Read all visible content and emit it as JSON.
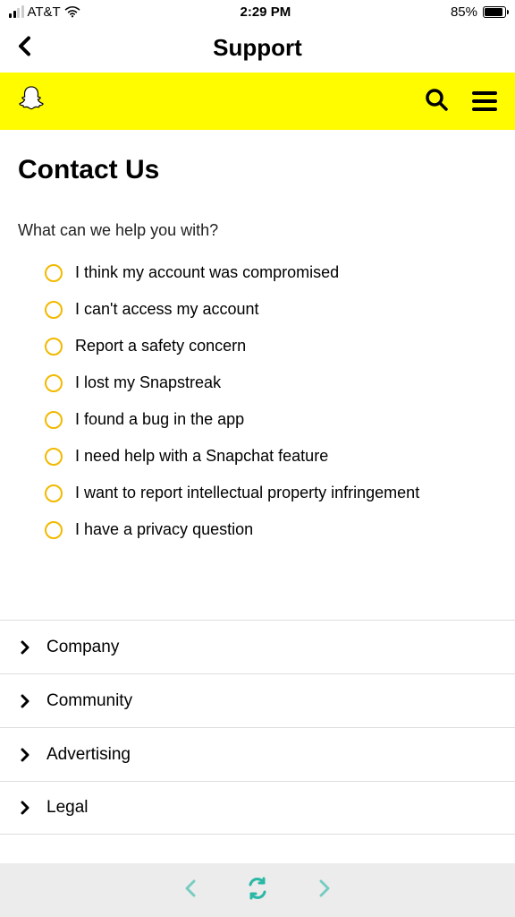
{
  "status": {
    "carrier": "AT&T",
    "time": "2:29 PM",
    "battery_pct": "85%"
  },
  "nav": {
    "title": "Support"
  },
  "page": {
    "title": "Contact Us",
    "prompt": "What can we help you with?"
  },
  "options": [
    "I think my account was compromised",
    "I can't access my account",
    "Report a safety concern",
    "I lost my Snapstreak",
    "I found a bug in the app",
    "I need help with a Snapchat feature",
    "I want to report intellectual property infringement",
    "I have a privacy question"
  ],
  "footer_sections": [
    "Company",
    "Community",
    "Advertising",
    "Legal"
  ],
  "colors": {
    "banner": "#FFFC00",
    "radio_ring": "#F2B900",
    "toolbar_bg": "#ECECEC",
    "toolbar_icon": "#2AB8A6"
  }
}
